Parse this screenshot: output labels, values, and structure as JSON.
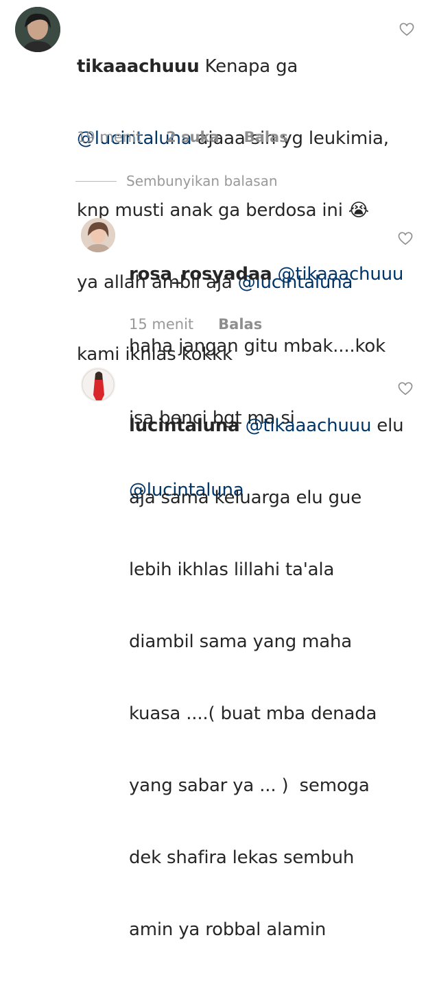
{
  "comments": [
    {
      "username": "tikaaachuuu",
      "lines": [
        [
          {
            "t": "Kenapa ga",
            "m": false
          }
        ],
        [
          {
            "t": "@lucintaluna",
            "m": true
          },
          {
            "t": " ajaaa sih yg leukimia,",
            "m": false
          }
        ],
        [
          {
            "t": "knp musti anak ga berdosa ini 😭",
            "m": false
          }
        ],
        [
          {
            "t": "ya allah ambil aja ",
            "m": false
          },
          {
            "t": "@lucintaluna",
            "m": true
          }
        ],
        [
          {
            "t": "kami ikhlas kokkk",
            "m": false
          }
        ]
      ],
      "time": "19 menit",
      "likes": "2 suka",
      "reply_label": "Balas"
    },
    {
      "username": "rosa_rosyadaa",
      "lines": [
        [
          {
            "t": "@tikaaachuuu",
            "m": true
          }
        ],
        [
          {
            "t": "haha jangan gitu mbak....kok",
            "m": false
          }
        ],
        [
          {
            "t": "isa benci bgt ma si",
            "m": false
          }
        ],
        [
          {
            "t": "@lucintaluna",
            "m": true
          }
        ]
      ],
      "time": "15 menit",
      "reply_label": "Balas"
    },
    {
      "username": "lucintaluna",
      "lines": [
        [
          {
            "t": "@tikaaachuuu",
            "m": true
          },
          {
            "t": " elu",
            "m": false
          }
        ],
        [
          {
            "t": "aja sama keluarga elu gue",
            "m": false
          }
        ],
        [
          {
            "t": "lebih ikhlas lillahi ta'ala",
            "m": false
          }
        ],
        [
          {
            "t": "diambil sama yang maha",
            "m": false
          }
        ],
        [
          {
            "t": "kuasa ....( buat mba denada",
            "m": false
          }
        ],
        [
          {
            "t": "yang sabar ya ... )  semoga",
            "m": false
          }
        ],
        [
          {
            "t": "dek shafira lekas sembuh",
            "m": false
          }
        ],
        [
          {
            "t": "amin ya robbal alamin",
            "m": false
          }
        ]
      ]
    }
  ],
  "hide_replies_label": "Sembunyikan balasan",
  "colors": {
    "mention": "#003569",
    "meta": "#999999",
    "text": "#262626"
  },
  "icons": {
    "like": "heart-outline-icon"
  }
}
